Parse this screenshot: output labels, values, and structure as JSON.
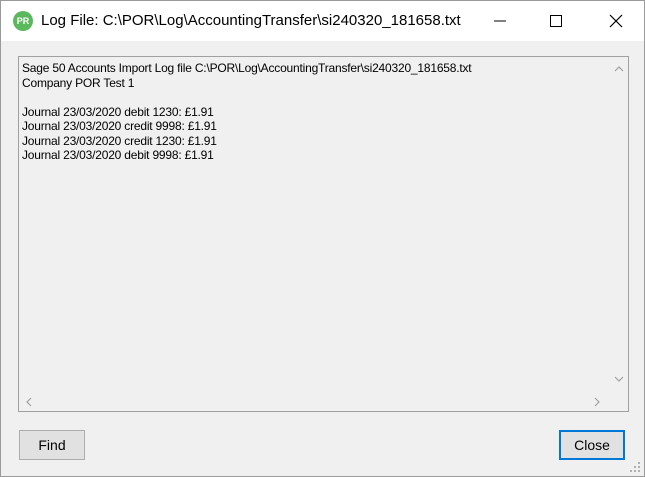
{
  "window": {
    "app_icon_text": "PR",
    "title": "Log File: C:\\POR\\Log\\AccountingTransfer\\si240320_181658.txt",
    "icons": {
      "app": "app-logo-icon",
      "minimize": "minimize-icon",
      "maximize": "maximize-icon",
      "close": "close-icon"
    }
  },
  "log": {
    "lines": [
      "Sage 50 Accounts Import Log file C:\\POR\\Log\\AccountingTransfer\\si240320_181658.txt",
      "Company POR Test 1",
      "",
      "Journal 23/03/2020 debit 1230: £1.91",
      "Journal 23/03/2020 credit 9998: £1.91",
      "Journal 23/03/2020 credit 1230: £1.91",
      "Journal 23/03/2020 debit 9998: £1.91"
    ]
  },
  "buttons": {
    "find_label": "Find",
    "close_label": "Close"
  },
  "colors": {
    "app_icon": "#5cb85c",
    "focus_border": "#0078d7",
    "window_bg": "#f0f0f0"
  }
}
